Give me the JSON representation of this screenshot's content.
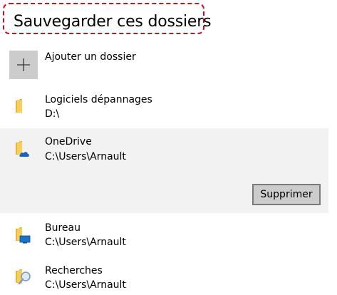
{
  "title": "Sauvegarder ces dossiers",
  "add_folder": {
    "label": "Ajouter un dossier",
    "icon": "plus-icon"
  },
  "folders": [
    {
      "name": "Logiciels dépannages",
      "path": "D:\\",
      "icon": "folder-icon"
    },
    {
      "name": "OneDrive",
      "path": "C:\\Users\\Arnault",
      "icon": "onedrive-folder-icon",
      "selected": true,
      "action_label": "Supprimer"
    },
    {
      "name": "Bureau",
      "path": "C:\\Users\\Arnault",
      "icon": "desktop-folder-icon"
    },
    {
      "name": "Recherches",
      "path": "C:\\Users\\Arnault",
      "icon": "search-folder-icon"
    }
  ],
  "colors": {
    "highlight_border": "#e0001b",
    "selected_row": "#f2f2f2",
    "button_gray": "#cccccc",
    "folder_yellow": "#f4c94d"
  }
}
